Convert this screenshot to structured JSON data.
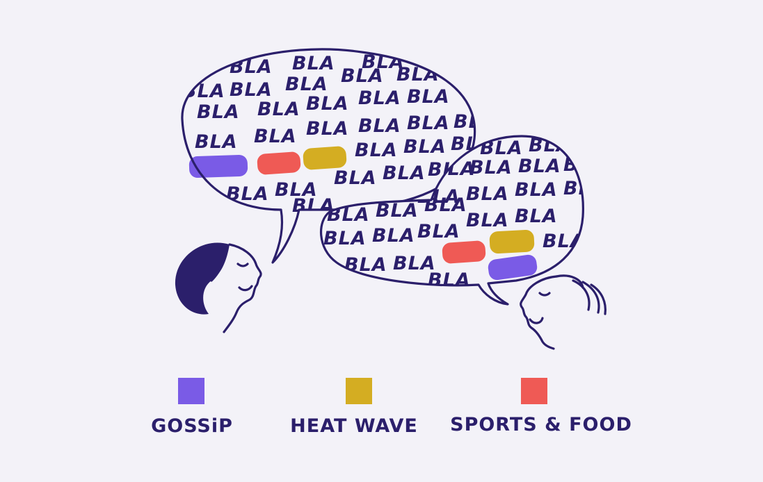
{
  "speech": {
    "word": "BLA"
  },
  "legend": {
    "items": [
      {
        "label": "GOSSiP",
        "color": "#7a5be6"
      },
      {
        "label": "HEAT WAVE",
        "color": "#d4ad22"
      },
      {
        "label": "SPORTS & FOOD",
        "color": "#ef5a55"
      }
    ]
  },
  "colors": {
    "background": "#f3f2f8",
    "ink": "#2b1f6b"
  }
}
